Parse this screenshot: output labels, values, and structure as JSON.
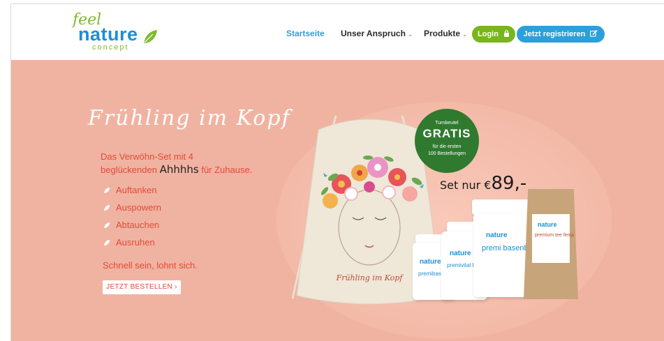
{
  "header": {
    "logo": {
      "feel": "feel",
      "nature": "nature",
      "concept": "concept"
    },
    "nav": [
      {
        "label": "Startseite",
        "active": true
      },
      {
        "label": "Unser Anspruch",
        "dropdown": true
      },
      {
        "label": "Produkte",
        "dropdown": true
      }
    ],
    "login_label": "Login",
    "register_label": "Jetzt registrieren"
  },
  "hero": {
    "script_title": "Frühling im Kopf",
    "lead_line1": "Das Verwöhn-Set mit 4",
    "lead_line2_pre": "beglückenden",
    "lead_ahh": "Ahhhhs",
    "lead_line2_post": "für Zuhause.",
    "bullets": [
      "Auftanken",
      "Auspowern",
      "Abtauchen",
      "Ausruhen"
    ],
    "tagline": "Schnell sein, lohnt sich.",
    "order_button": "JETZT BESTELLEN",
    "badge": {
      "top": "Turnbeutel",
      "main": "GRATIS",
      "line1": "für die ersten",
      "line2": "100 Bestellungen"
    },
    "price_pre": "Set nur €",
    "price_value": "89,-",
    "bag_script": "Frühling im Kopf",
    "products": {
      "p1": "premibase komplex",
      "p2": "premivital B komplex",
      "p3": "premi basenbad",
      "p4": "premium tee fenja"
    }
  },
  "colors": {
    "hero_bg": "#f0b3a1",
    "accent_red": "#e24a3a",
    "brand_blue": "#2d9fd9",
    "brand_green": "#79b51c",
    "badge_green": "#2f7a2f"
  }
}
